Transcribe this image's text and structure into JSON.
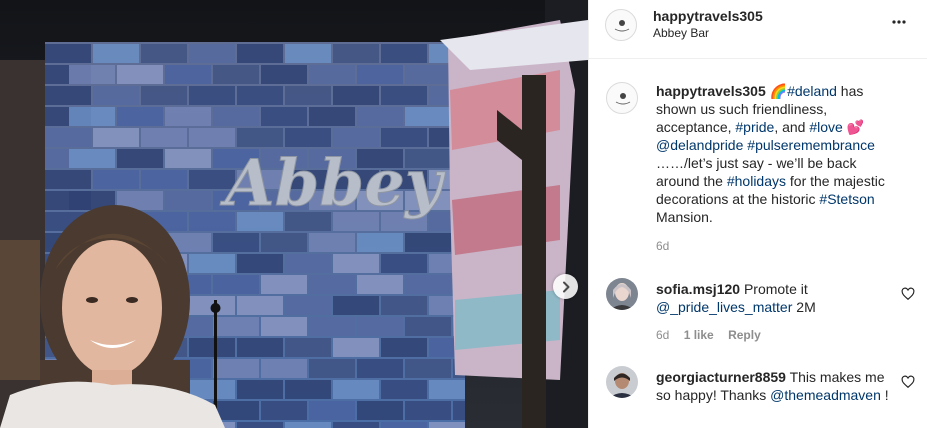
{
  "post": {
    "author": "happytravels305",
    "location": "Abbey Bar",
    "more_icon": "more-horizontal-icon"
  },
  "caption": {
    "username": "happytravels305",
    "emoji_rainbow": "🌈",
    "tag_deland": "#deland",
    "text1": " has shown us such friendliness, acceptance, ",
    "tag_pride": "#pride",
    "text2": ", and ",
    "tag_love": "#love",
    "emoji_heart": "💕",
    "mention_delandpride": "@delandpride",
    "tag_pulseremembrance": "#pulseremembrance",
    "text3": " ……/let’s just say - we’ll be back around the ",
    "tag_holidays": "#holidays",
    "text4": " for the majestic decorations at the historic ",
    "tag_stetson": "#Stetson",
    "text5": " Mansion.",
    "time": "6d"
  },
  "comments": [
    {
      "username": "sofia.msj120",
      "text": " Promote it ",
      "mention": "@_pride_lives_matter",
      "suffix": " 2M",
      "time": "6d",
      "likes": "1 like",
      "reply": "Reply"
    },
    {
      "username": "georgiacturner8859",
      "text": " This makes me so happy! Thanks ",
      "mention": "@themeadmaven",
      "suffix": " !"
    }
  ],
  "photo": {
    "sign_text": "Abbey",
    "next_icon": "chevron-right-icon"
  },
  "colors": {
    "link": "#00376b",
    "muted": "#8e8e8e",
    "text": "#262626"
  }
}
